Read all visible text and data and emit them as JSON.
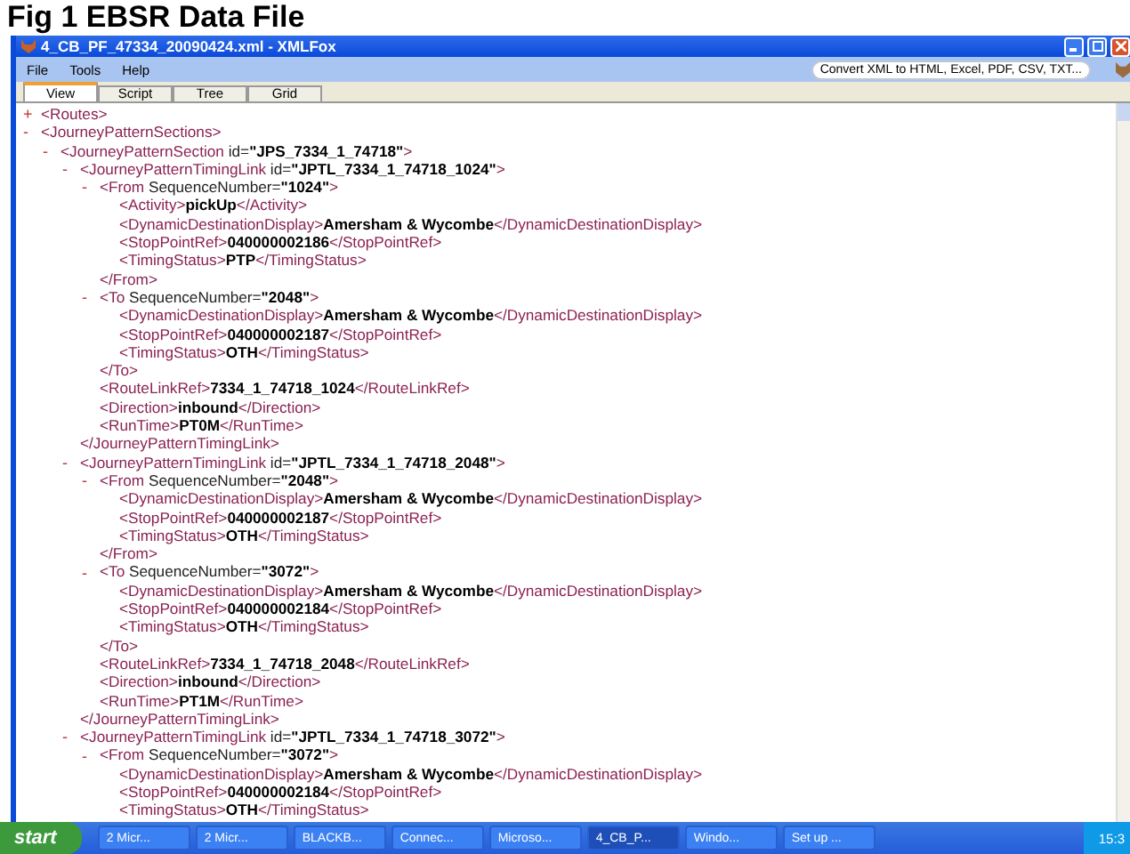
{
  "slide_title": "Fig 1 EBSR Data File",
  "window": {
    "title": "4_CB_PF_47334_20090424.xml - XMLFox"
  },
  "menu": [
    "File",
    "Tools",
    "Help"
  ],
  "promo_button": "Convert XML to HTML, Excel, PDF, CSV, TXT...",
  "tabs": [
    {
      "label": "View",
      "selected": true
    },
    {
      "label": "Script",
      "selected": false
    },
    {
      "label": "Tree",
      "selected": false
    },
    {
      "label": "Grid",
      "selected": false
    }
  ],
  "xml": [
    {
      "toggle": "+",
      "open": "<Routes>"
    },
    {
      "toggle": "-",
      "open": "<JourneyPatternSections>",
      "children": [
        {
          "toggle": "-",
          "open": "<JourneyPatternSection",
          "attr": " id=",
          "value": "\"JPS_7334_1_74718\"",
          "tail": ">",
          "children": [
            {
              "toggle": "-",
              "open": "<JourneyPatternTimingLink",
              "attr": " id=",
              "value": "\"JPTL_7334_1_74718_1024\"",
              "tail": ">",
              "children": [
                {
                  "toggle": "-",
                  "open": "<From",
                  "attr": " SequenceNumber=",
                  "value": "\"1024\"",
                  "tail": ">",
                  "children": [
                    {
                      "open": "<Activity>",
                      "text": "pickUp",
                      "close": "</Activity>"
                    },
                    {
                      "open": "<DynamicDestinationDisplay>",
                      "text": "Amersham & Wycombe",
                      "close": "</DynamicDestinationDisplay>"
                    },
                    {
                      "open": "<StopPointRef>",
                      "text": "040000002186",
                      "close": "</StopPointRef>"
                    },
                    {
                      "open": "<TimingStatus>",
                      "text": "PTP",
                      "close": "</TimingStatus>"
                    }
                  ],
                  "end": "</From>"
                },
                {
                  "toggle": "-",
                  "open": "<To",
                  "attr": " SequenceNumber=",
                  "value": "\"2048\"",
                  "tail": ">",
                  "children": [
                    {
                      "open": "<DynamicDestinationDisplay>",
                      "text": "Amersham & Wycombe",
                      "close": "</DynamicDestinationDisplay>"
                    },
                    {
                      "open": "<StopPointRef>",
                      "text": "040000002187",
                      "close": "</StopPointRef>"
                    },
                    {
                      "open": "<TimingStatus>",
                      "text": "OTH",
                      "close": "</TimingStatus>"
                    }
                  ],
                  "end": "</To>"
                },
                {
                  "open": "<RouteLinkRef>",
                  "text": "7334_1_74718_1024",
                  "close": "</RouteLinkRef>"
                },
                {
                  "open": "<Direction>",
                  "text": "inbound",
                  "close": "</Direction>"
                },
                {
                  "open": "<RunTime>",
                  "text": "PT0M",
                  "close": "</RunTime>"
                }
              ],
              "end": "</JourneyPatternTimingLink>"
            },
            {
              "toggle": "-",
              "open": "<JourneyPatternTimingLink",
              "attr": " id=",
              "value": "\"JPTL_7334_1_74718_2048\"",
              "tail": ">",
              "children": [
                {
                  "toggle": "-",
                  "open": "<From",
                  "attr": " SequenceNumber=",
                  "value": "\"2048\"",
                  "tail": ">",
                  "children": [
                    {
                      "open": "<DynamicDestinationDisplay>",
                      "text": "Amersham & Wycombe",
                      "close": "</DynamicDestinationDisplay>"
                    },
                    {
                      "open": "<StopPointRef>",
                      "text": "040000002187",
                      "close": "</StopPointRef>"
                    },
                    {
                      "open": "<TimingStatus>",
                      "text": "OTH",
                      "close": "</TimingStatus>"
                    }
                  ],
                  "end": "</From>"
                },
                {
                  "toggle": "-",
                  "open": "<To",
                  "attr": " SequenceNumber=",
                  "value": "\"3072\"",
                  "tail": ">",
                  "children": [
                    {
                      "open": "<DynamicDestinationDisplay>",
                      "text": "Amersham & Wycombe",
                      "close": "</DynamicDestinationDisplay>"
                    },
                    {
                      "open": "<StopPointRef>",
                      "text": "040000002184",
                      "close": "</StopPointRef>"
                    },
                    {
                      "open": "<TimingStatus>",
                      "text": "OTH",
                      "close": "</TimingStatus>"
                    }
                  ],
                  "end": "</To>"
                },
                {
                  "open": "<RouteLinkRef>",
                  "text": "7334_1_74718_2048",
                  "close": "</RouteLinkRef>"
                },
                {
                  "open": "<Direction>",
                  "text": "inbound",
                  "close": "</Direction>"
                },
                {
                  "open": "<RunTime>",
                  "text": "PT1M",
                  "close": "</RunTime>"
                }
              ],
              "end": "</JourneyPatternTimingLink>"
            },
            {
              "toggle": "-",
              "open": "<JourneyPatternTimingLink",
              "attr": " id=",
              "value": "\"JPTL_7334_1_74718_3072\"",
              "tail": ">",
              "children": [
                {
                  "toggle": "-",
                  "open": "<From",
                  "attr": " SequenceNumber=",
                  "value": "\"3072\"",
                  "tail": ">",
                  "children": [
                    {
                      "open": "<DynamicDestinationDisplay>",
                      "text": "Amersham & Wycombe",
                      "close": "</DynamicDestinationDisplay>"
                    },
                    {
                      "open": "<StopPointRef>",
                      "text": "040000002184",
                      "close": "</StopPointRef>"
                    },
                    {
                      "open": "<TimingStatus>",
                      "text": "OTH",
                      "close": "</TimingStatus>"
                    }
                  ]
                }
              ]
            }
          ]
        }
      ]
    }
  ],
  "taskbar": {
    "start": "start",
    "items": [
      {
        "label": "2 Micr...",
        "selected": false
      },
      {
        "label": "2 Micr...",
        "selected": false
      },
      {
        "label": "BLACKB...",
        "selected": false
      },
      {
        "label": "Connec...",
        "selected": false
      },
      {
        "label": "Microso...",
        "selected": false
      },
      {
        "label": "4_CB_P...",
        "selected": true
      },
      {
        "label": "Windo...",
        "selected": false
      },
      {
        "label": "Set up ...",
        "selected": false
      }
    ],
    "clock": "15:3"
  }
}
